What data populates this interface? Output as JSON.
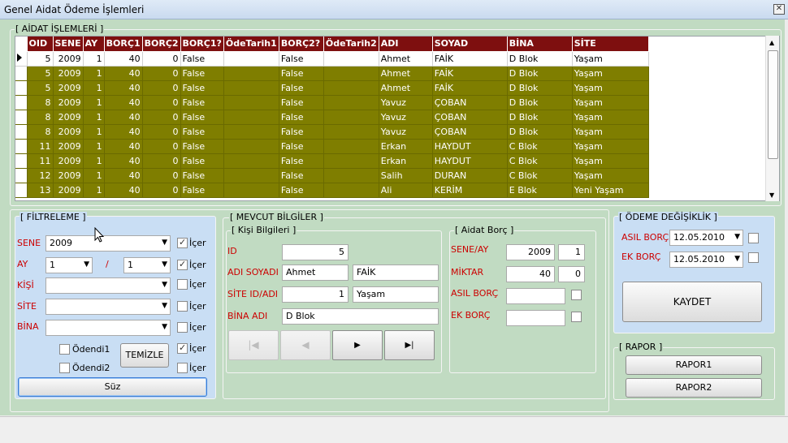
{
  "window": {
    "title": "Genel Aidat Ödeme İşlemleri",
    "close_icon": "✕"
  },
  "aidat_group": {
    "legend": "[ AİDAT İŞLEMLERİ ]"
  },
  "grid": {
    "columns": [
      "OID",
      "SENE",
      "AY",
      "BORÇ1",
      "BORÇ2",
      "BORÇ1?",
      "ÖdeTarih1",
      "BORÇ2?",
      "ÖdeTarih2",
      "ADI",
      "SOYAD",
      "BİNA",
      "SİTE"
    ],
    "rows": [
      [
        "5",
        "2009",
        "1",
        "40",
        "0",
        "False",
        "",
        "False",
        "",
        "Ahmet",
        "FAİK",
        "D Blok",
        "Yaşam"
      ],
      [
        "5",
        "2009",
        "1",
        "40",
        "0",
        "False",
        "",
        "False",
        "",
        "Ahmet",
        "FAİK",
        "D Blok",
        "Yaşam"
      ],
      [
        "5",
        "2009",
        "1",
        "40",
        "0",
        "False",
        "",
        "False",
        "",
        "Ahmet",
        "FAİK",
        "D Blok",
        "Yaşam"
      ],
      [
        "8",
        "2009",
        "1",
        "40",
        "0",
        "False",
        "",
        "False",
        "",
        "Yavuz",
        "ÇOBAN",
        "D Blok",
        "Yaşam"
      ],
      [
        "8",
        "2009",
        "1",
        "40",
        "0",
        "False",
        "",
        "False",
        "",
        "Yavuz",
        "ÇOBAN",
        "D Blok",
        "Yaşam"
      ],
      [
        "8",
        "2009",
        "1",
        "40",
        "0",
        "False",
        "",
        "False",
        "",
        "Yavuz",
        "ÇOBAN",
        "D Blok",
        "Yaşam"
      ],
      [
        "11",
        "2009",
        "1",
        "40",
        "0",
        "False",
        "",
        "False",
        "",
        "Erkan",
        "HAYDUT",
        "C Blok",
        "Yaşam"
      ],
      [
        "11",
        "2009",
        "1",
        "40",
        "0",
        "False",
        "",
        "False",
        "",
        "Erkan",
        "HAYDUT",
        "C Blok",
        "Yaşam"
      ],
      [
        "12",
        "2009",
        "1",
        "40",
        "0",
        "False",
        "",
        "False",
        "",
        "Salih",
        "DURAN",
        "C Blok",
        "Yaşam"
      ],
      [
        "13",
        "2009",
        "1",
        "40",
        "0",
        "False",
        "",
        "False",
        "",
        "Ali",
        "KERİM",
        "E Blok",
        "Yeni Yaşam"
      ]
    ]
  },
  "filter": {
    "legend": "[ FİLTRELEME ]",
    "sene_label": "SENE",
    "sene_value": "2009",
    "ay_label": "AY",
    "ay_value1": "1",
    "ay_sep": "/",
    "ay_value2": "1",
    "kisi_label": "KİŞİ",
    "site_label": "SİTE",
    "bina_label": "BİNA",
    "icer": "İçer",
    "odendi1": "Ödendi1",
    "odendi2": "Ödendi2",
    "temizle": "TEMİZLE",
    "suz": "Süz"
  },
  "mevcut": {
    "legend": "[ MEVCUT BİLGİLER ]",
    "kisi_legend": "[ Kişi Bilgileri ]",
    "id_label": "ID",
    "id_value": "5",
    "adsoyad_label": "ADI SOYADI",
    "adi_value": "Ahmet",
    "soyad_value": "FAİK",
    "site_label": "SİTE ID/ADI",
    "site_id_value": "1",
    "site_name_value": "Yaşam",
    "bina_label": "BİNA ADI",
    "bina_value": "D Blok",
    "nav_first": "|◀",
    "nav_prev": "◀",
    "nav_next": "▶",
    "nav_last": "▶|"
  },
  "aidat_borc": {
    "legend": "[ Aidat Borç ]",
    "sene_ay_label": "SENE/AY",
    "sene_value": "2009",
    "ay_value": "1",
    "miktar_label": "MİKTAR",
    "miktar1": "40",
    "miktar2": "0",
    "asil_label": "ASIL BORÇ",
    "ek_label": "EK BORÇ"
  },
  "odeme": {
    "legend": "[ ÖDEME DEĞİŞİKLİK ]",
    "asil_label": "ASIL BORÇ",
    "asil_date": "12.05.2010",
    "ek_label": "EK BORÇ",
    "ek_date": "12.05.2010",
    "kaydet": "KAYDET"
  },
  "rapor": {
    "legend": "[ RAPOR ]",
    "rapor1": "RAPOR1",
    "rapor2": "RAPOR2"
  },
  "cursor_icon": "arrow-pointer"
}
